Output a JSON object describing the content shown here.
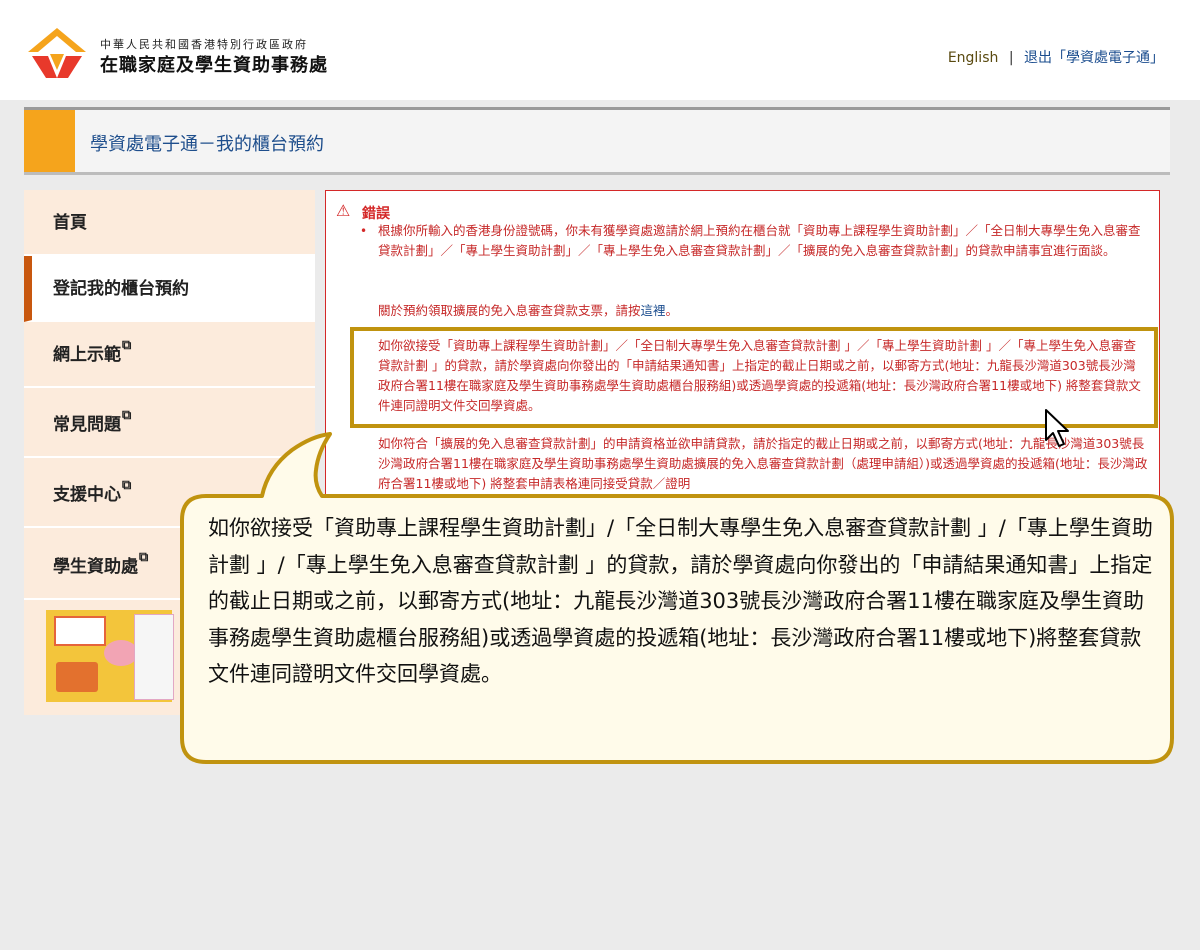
{
  "header": {
    "org_small": "中華人民共和國香港特別行政區政府",
    "org_name": "在職家庭及學生資助事務處",
    "link_english": "English",
    "separator": "|",
    "link_logout": "退出「學資處電子通」"
  },
  "page_title": "學資處電子通－我的櫃台預約",
  "sidebar": {
    "items": [
      {
        "label": "首頁",
        "external": false,
        "active": false
      },
      {
        "label": "登記我的櫃台預約",
        "external": false,
        "active": true
      },
      {
        "label": "網上示範",
        "external": true,
        "active": false
      },
      {
        "label": "常見問題",
        "external": true,
        "active": false
      },
      {
        "label": "支援中心",
        "external": true,
        "active": false
      },
      {
        "label": "學生資助處",
        "external": true,
        "active": false
      }
    ],
    "external_icon": "external-link-icon"
  },
  "error": {
    "icon": "warning-icon",
    "title": "錯誤",
    "message1": "根據你所輸入的香港身份證號碼，你未有獲學資處邀請於網上預約在櫃台就「資助專上課程學生資助計劃」／「全日制大專學生免入息審查貸款計劃」／「專上學生資助計劃」／「專上學生免入息審查貸款計劃」／「擴展的免入息審查貸款計劃」的貸款申請事宜進行面談。",
    "message2_prefix": "關於預約領取擴展的免入息審查貸款支票，請按",
    "message2_link": "這裡",
    "message2_suffix": "。",
    "message3": "如你欲接受「資助專上課程學生資助計劃」／「全日制大專學生免入息審查貸款計劃 」／「專上學生資助計劃 」／「專上學生免入息審查貸款計劃 」的貸款，請於學資處向你發出的「申請結果通知書」上指定的截止日期或之前，以郵寄方式(地址：九龍長沙灣道303號長沙灣政府合署11樓在職家庭及學生資助事務處學生資助處櫃台服務組)或透過學資處的投遞箱(地址：長沙灣政府合署11樓或地下) 將整套貸款文件連同證明文件交回學資處。",
    "message4": "如你符合「擴展的免入息審查貸款計劃」的申請資格並欲申請貸款，請於指定的截止日期或之前，以郵寄方式(地址：九龍長沙灣道303號長沙灣政府合署11樓在職家庭及學生資助事務處學生資助處擴展的免入息審查貸款計劃（處理申請組）)或透過學資處的投遞箱(地址：長沙灣政府合署11樓或地下) 將整套申請表格連同接受貸款／證明"
  },
  "callout": {
    "text": "如你欲接受「資助專上課程學生資助計劃」/「全日制大專學生免入息審查貸款計劃 」/「專上學生資助計劃 」/「專上學生免入息審查貸款計劃 」的貸款，請於學資處向你發出的「申請結果通知書」上指定的截止日期或之前，以郵寄方式(地址：九龍長沙灣道303號長沙灣政府合署11樓在職家庭及學生資助事務處學生資助處櫃台服務組)或透過學資處的投遞箱(地址：長沙灣政府合署11樓或地下)將整套貸款文件連同證明文件交回學資處。"
  },
  "colors": {
    "accent_orange": "#f5a41c",
    "active_marker": "#c8570e",
    "error_red": "#d42828",
    "highlight_gold": "#c0930f",
    "callout_fill": "#fffbea",
    "link_blue": "#1a4c8e"
  }
}
